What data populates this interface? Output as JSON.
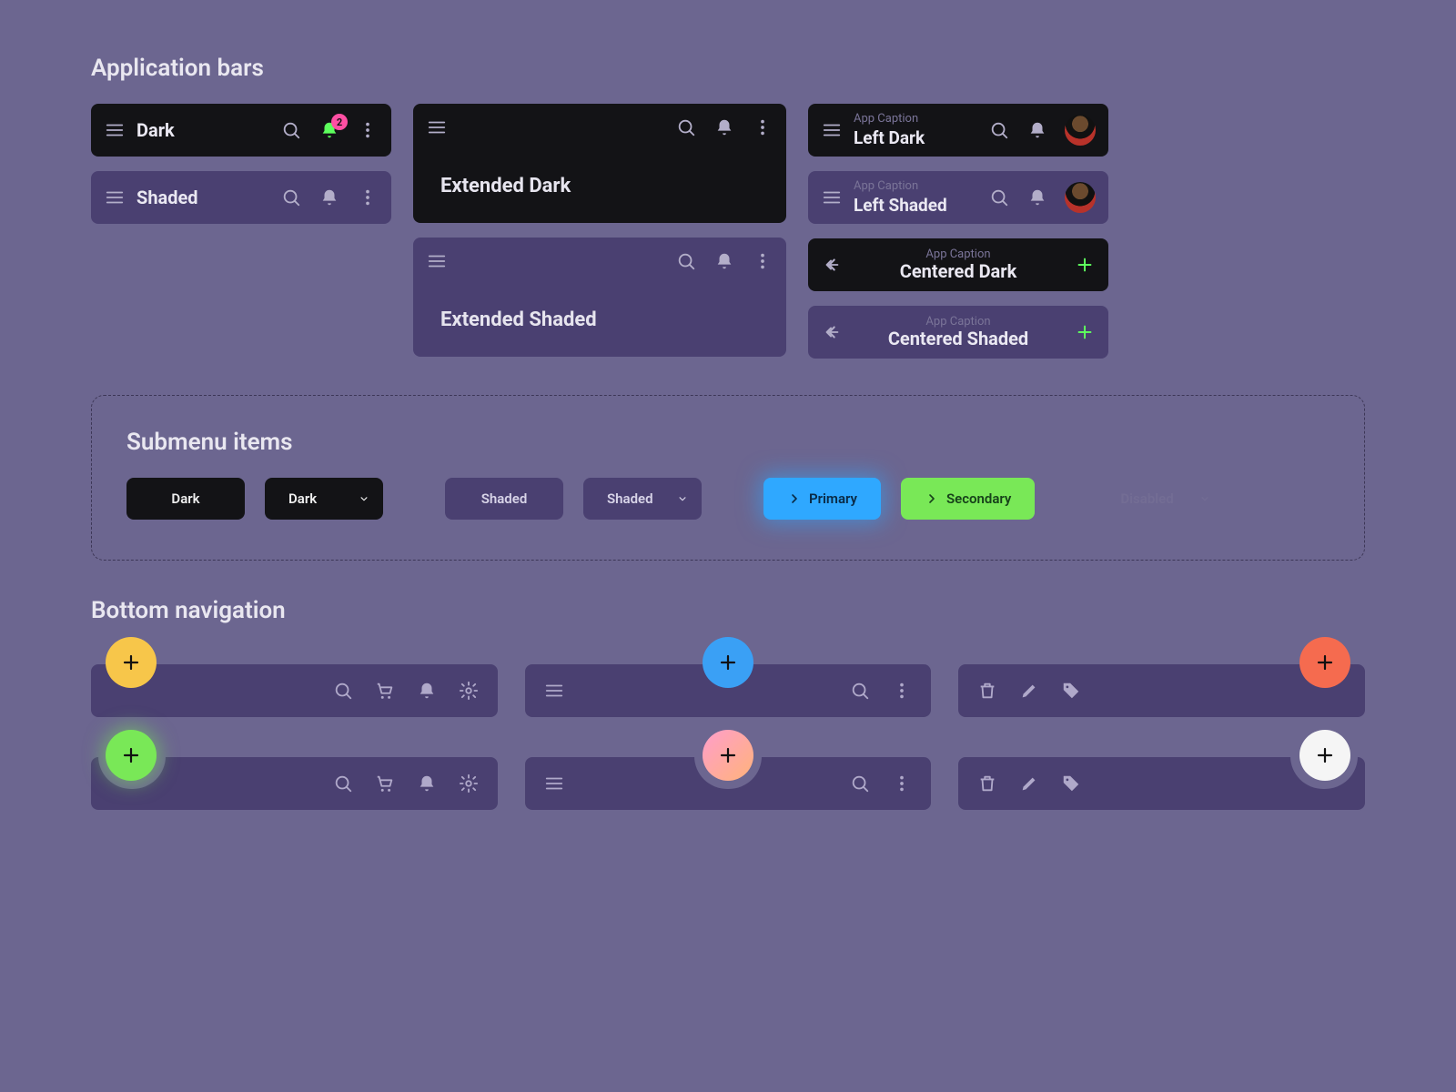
{
  "sections": {
    "appbars": "Application bars",
    "submenu": "Submenu items",
    "bottomnav": "Bottom navigation"
  },
  "appbars": {
    "dark": {
      "title": "Dark",
      "badge": "2"
    },
    "shaded": {
      "title": "Shaded"
    },
    "extended_dark": {
      "title": "Extended Dark"
    },
    "extended_shaded": {
      "title": "Extended Shaded"
    },
    "left_dark": {
      "caption": "App Caption",
      "title": "Left Dark"
    },
    "left_shaded": {
      "caption": "App Caption",
      "title": "Left Shaded"
    },
    "centered_dark": {
      "caption": "App Caption",
      "title": "Centered Dark"
    },
    "centered_shaded": {
      "caption": "App Caption",
      "title": "Centered Shaded"
    }
  },
  "submenu": {
    "dark": "Dark",
    "dark_dd": "Dark",
    "shaded": "Shaded",
    "shaded_dd": "Shaded",
    "primary": "Primary",
    "secondary": "Secondary",
    "disabled": "Disabled"
  },
  "colors": {
    "dark": "#131316",
    "shaded": "#4a4071",
    "primary": "#2fa8ff",
    "secondary": "#79e857",
    "fab_yellow": "#f7c64a",
    "fab_blue": "#3aa0f5",
    "fab_coral": "#f56b4f",
    "fab_green": "#79e857",
    "fab_white": "#f5f5f5",
    "badge": "#ff4fa3",
    "bell_active": "#5dff5d"
  }
}
